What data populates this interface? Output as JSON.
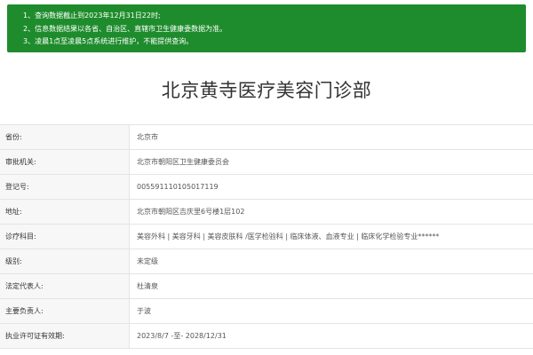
{
  "notice": {
    "lines": [
      "1、查询数据截止到2023年12月31日22时;",
      "2、信息数据结果以各省、自治区、直辖市卫生健康委数据为准。",
      "3、凌晨1点至凌晨5点系统进行维护，不能提供查询。"
    ]
  },
  "title": "北京黄寺医疗美容门诊部",
  "info": [
    {
      "label": "省份:",
      "value": "北京市"
    },
    {
      "label": "审批机关:",
      "value": "北京市朝阳区卫生健康委员会"
    },
    {
      "label": "登记号:",
      "value": "005591110105017119"
    },
    {
      "label": "地址:",
      "value": "北京市朝阳区吉庆里6号楼1层102"
    },
    {
      "label": "诊疗科目:",
      "value": "美容外科 | 美容牙科 | 美容皮肤科 /医学检验科 | 临床体液、血液专业 | 临床化学检验专业******"
    },
    {
      "label": "级别:",
      "value": "未定级"
    },
    {
      "label": "法定代表人:",
      "value": "杜清泉"
    },
    {
      "label": "主要负责人:",
      "value": "于波"
    },
    {
      "label": "执业许可证有效期:",
      "value": "2023/8/7 -至- 2028/12/31"
    }
  ]
}
